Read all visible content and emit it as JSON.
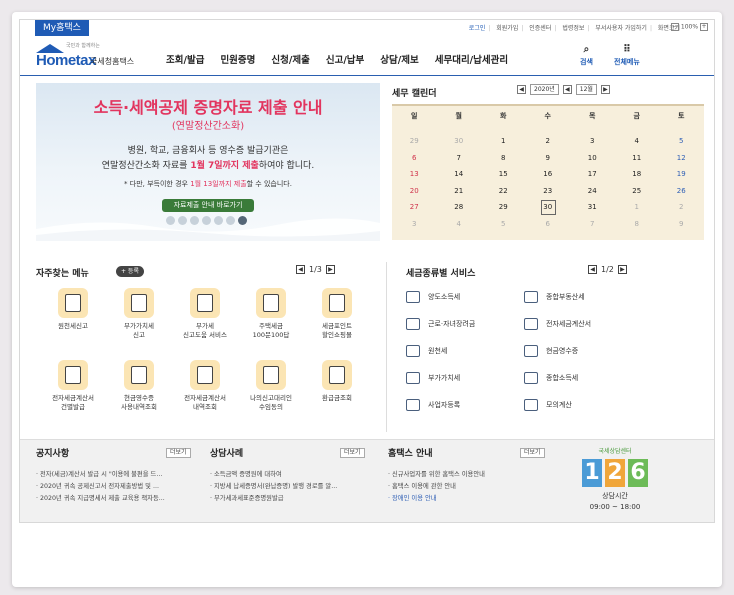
{
  "utilbar": {
    "my_tab": "My홈택스",
    "links": [
      "로그인",
      "회원가입",
      "인증센터",
      "법령정보",
      "부서사용자 가입하기",
      "화면크기"
    ],
    "zoom_minus": "−",
    "zoom_level": "100%",
    "zoom_plus": "+"
  },
  "header": {
    "logo_tagline": "국민과 함께하는",
    "logo_main": "Hometax",
    "logo_sub": "국세청홈택스",
    "nav": [
      "조회/발급",
      "민원증명",
      "신청/제출",
      "신고/납부",
      "상담/제보",
      "세무대리/납세관리"
    ],
    "search_label": "검색",
    "menu_label": "전체메뉴",
    "accent_color": "#1f5bb5"
  },
  "banner": {
    "title": "소득·세액공제 증명자료 제출 안내",
    "subtitle": "(연말정산간소화)",
    "line1": "병원, 학교, 금융회사 등 영수증 발급기관은",
    "line2_pre": "연말정산간소화 자료를 ",
    "line2_hl": "1월 7일까지 제출",
    "line2_post": "하여야 합니다.",
    "note_pre": "* 다만, 부득이한 경우 ",
    "note_hl": "1월 13일까지 제출",
    "note_post": "할 수 있습니다.",
    "button": "자료제출 안내 바로가기",
    "slides": 7,
    "active_slide": 7,
    "highlight_color": "#e2345e"
  },
  "calendar": {
    "title": "세무 캘린더",
    "prev_arrow": "◀",
    "next_arrow": "▶",
    "year": "2020년",
    "month": "12월",
    "weekdays": [
      "일",
      "월",
      "화",
      "수",
      "목",
      "금",
      "토"
    ],
    "weeks": [
      [
        "29",
        "30",
        "1",
        "2",
        "3",
        "4",
        "5"
      ],
      [
        "6",
        "7",
        "8",
        "9",
        "10",
        "11",
        "12"
      ],
      [
        "13",
        "14",
        "15",
        "16",
        "17",
        "18",
        "19"
      ],
      [
        "20",
        "21",
        "22",
        "23",
        "24",
        "25",
        "26"
      ],
      [
        "27",
        "28",
        "29",
        "30",
        "31",
        "1",
        "2"
      ],
      [
        "3",
        "4",
        "5",
        "6",
        "7",
        "8",
        "9"
      ]
    ],
    "today": "30"
  },
  "favorites": {
    "title": "자주찾는 메뉴",
    "register": "+ 등록",
    "page": "1/3",
    "items": [
      {
        "label": "원천세신고",
        "icon": "calculator-icon"
      },
      {
        "label": "부가가치세\n신고",
        "icon": "vat-document-icon"
      },
      {
        "label": "부가세\n신고도움 서비스",
        "icon": "assist-document-icon"
      },
      {
        "label": "주택세금\n100문100답",
        "icon": "building-icon"
      },
      {
        "label": "세금포인트\n할인쇼핑몰",
        "icon": "shopping-bag-icon"
      },
      {
        "label": "전자세금계산서\n건별발급",
        "icon": "invoice-icon"
      },
      {
        "label": "현금영수증\n사용내역조회",
        "icon": "receipt-icon"
      },
      {
        "label": "전자세금계산서\n내역조회",
        "icon": "invoice-search-icon"
      },
      {
        "label": "나의신고대리인\n수임동의",
        "icon": "agent-icon"
      },
      {
        "label": "환급금조회",
        "icon": "refund-icon"
      }
    ]
  },
  "tax_services": {
    "title": "세금종류별 서비스",
    "page": "1/2",
    "items": [
      {
        "label": "양도소득세",
        "icon": "transfer-icon"
      },
      {
        "label": "종합부동산세",
        "icon": "real-estate-icon"
      },
      {
        "label": "근로·자녀장려금",
        "icon": "heart-coin-icon"
      },
      {
        "label": "전자세금계산서",
        "icon": "e-invoice-icon"
      },
      {
        "label": "원천세",
        "icon": "withholding-icon"
      },
      {
        "label": "현금영수증",
        "icon": "cash-receipt-icon"
      },
      {
        "label": "부가가치세",
        "icon": "vat-icon"
      },
      {
        "label": "종합소득세",
        "icon": "income-tax-icon"
      },
      {
        "label": "사업자등록",
        "icon": "business-reg-icon"
      },
      {
        "label": "모의계산",
        "icon": "calculator-icon"
      }
    ]
  },
  "notices": {
    "title": "공지사항",
    "more": "더보기",
    "items": [
      "전자(세금)계산서 발급 시 \"이용에 불편을 드...",
      "2020년 귀속 공제신고서 전자제출방법 및 ...",
      "2020년 귀속 지급명세서 제출 교육용 책자등..."
    ]
  },
  "cases": {
    "title": "상담사례",
    "more": "더보기",
    "items": [
      "소득금액 증명원에 대하여",
      "지방세 납세증명서(완납증명) 발행 경로를 알...",
      "부가세과세표준증명원발급"
    ]
  },
  "guide": {
    "title": "홈택스 안내",
    "more": "더보기",
    "items": [
      "신규사업자를 위한 홈택스 이용안내",
      "홈택스 이용에 관한 안내",
      "장애인 이용 안내"
    ]
  },
  "promo": {
    "top": "국세상담센터",
    "digits": [
      "1",
      "2",
      "6"
    ],
    "digit_colors": [
      "#4b9bd6",
      "#f0a63a",
      "#6dbb58"
    ],
    "label": "상담시간",
    "hours": "09:00 ~ 18:00"
  }
}
